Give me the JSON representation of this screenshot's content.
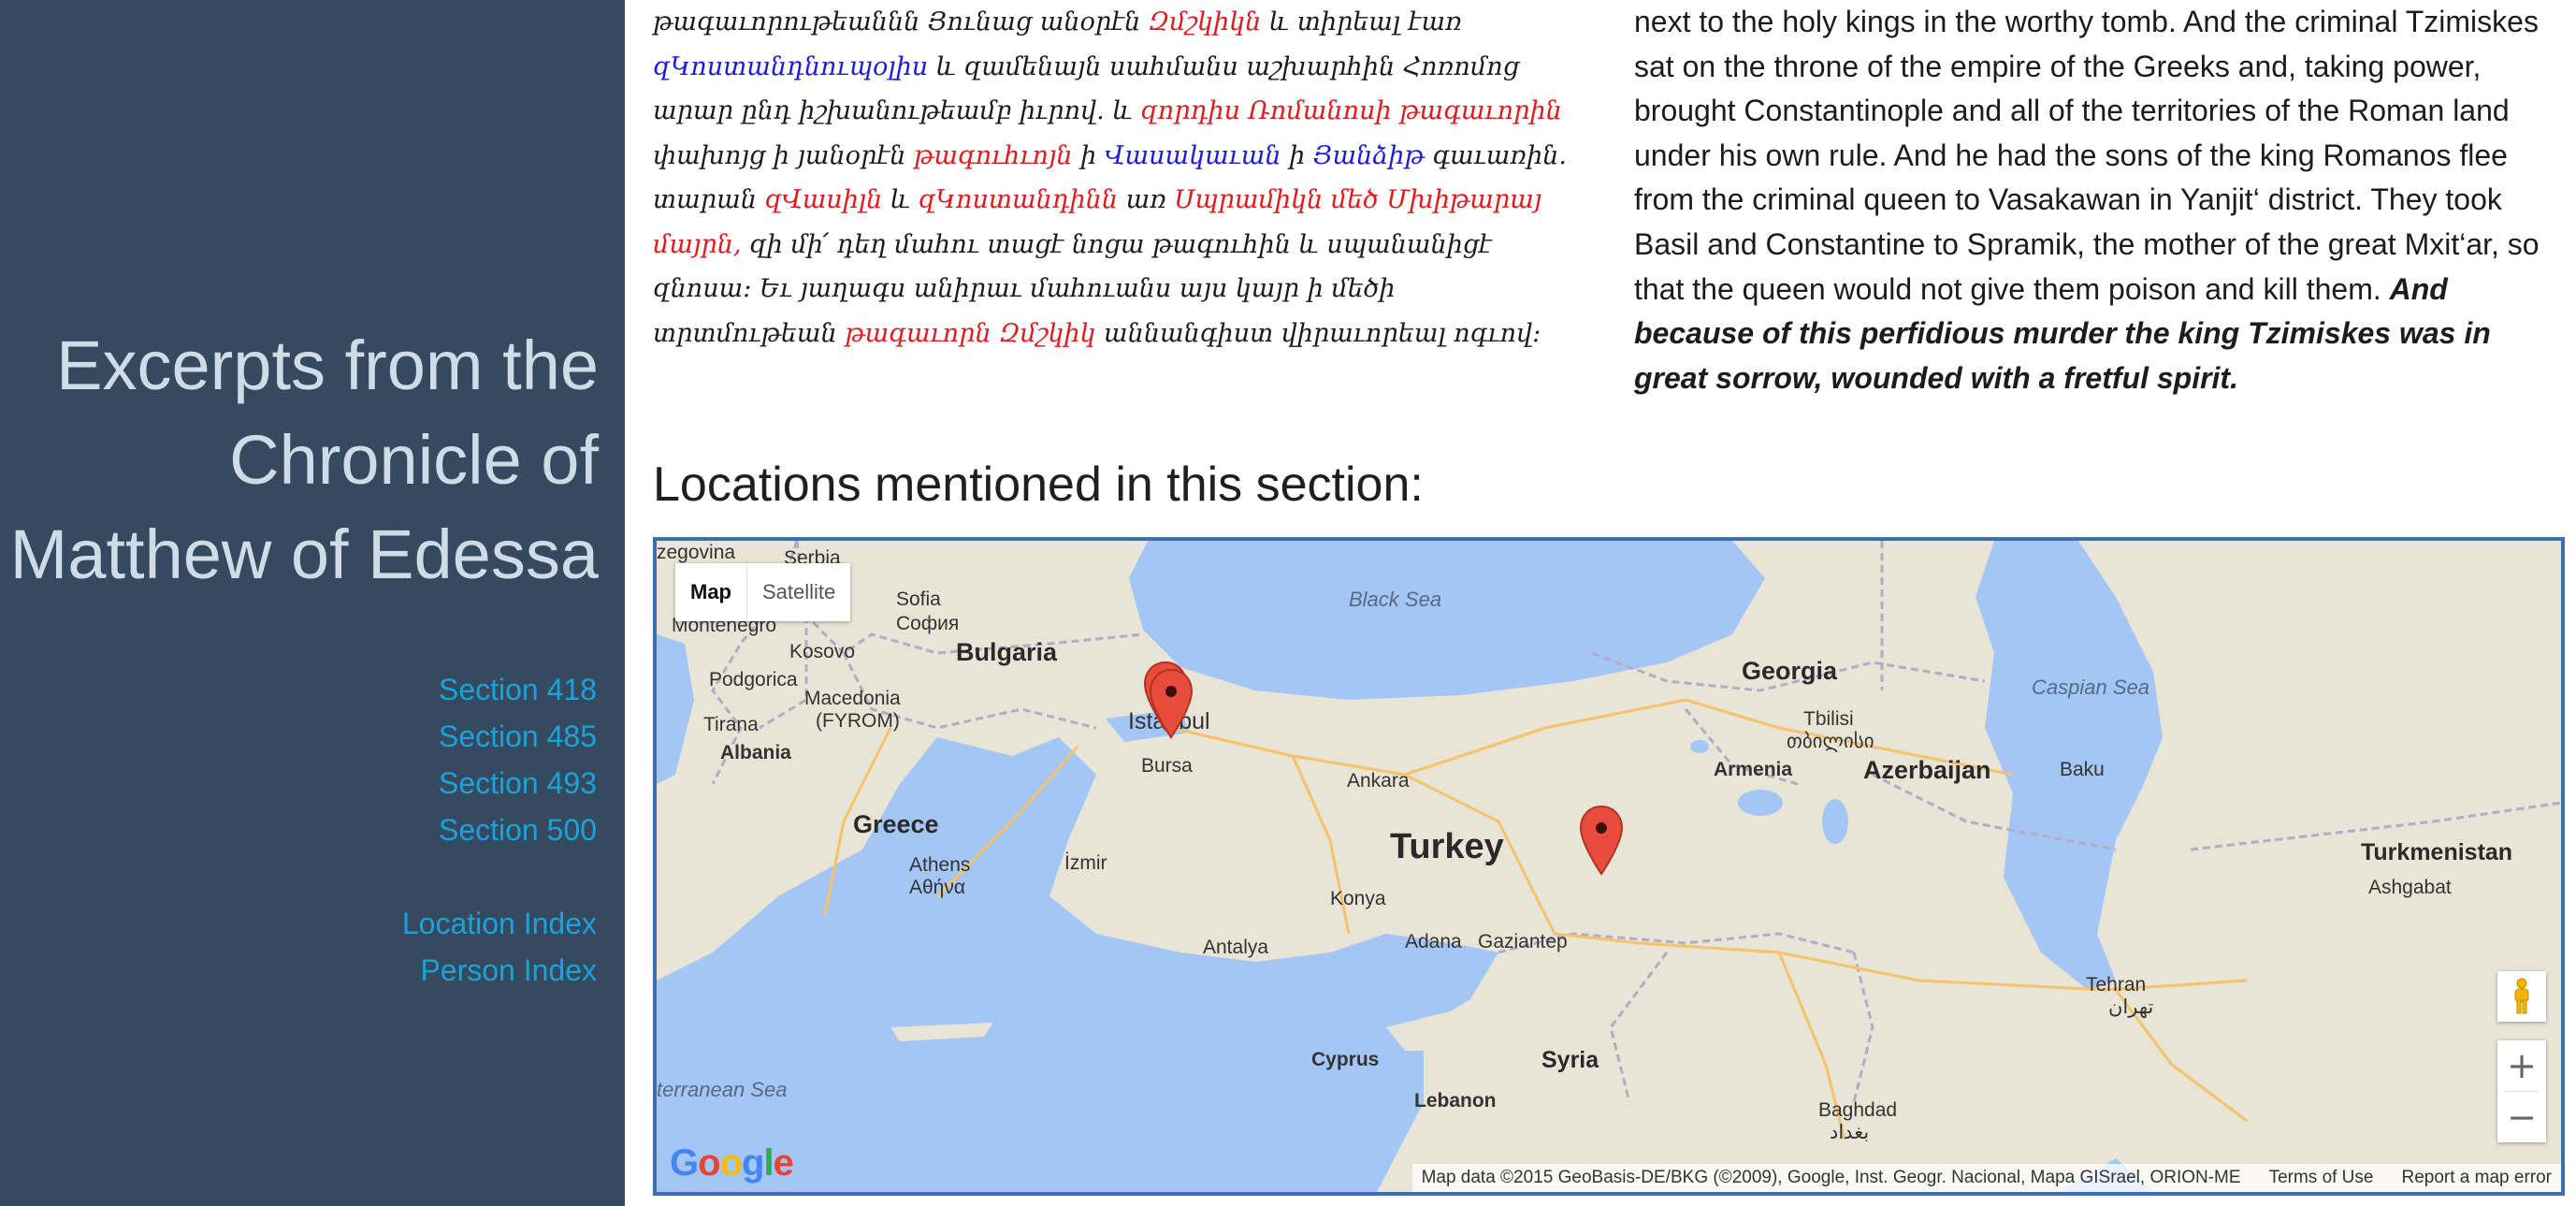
{
  "sidebar": {
    "title": "Excerpts from the Chronicle of Matthew of Edessa",
    "sections": [
      "Section 418",
      "Section 485",
      "Section 493",
      "Section 500"
    ],
    "indexes": [
      "Location Index",
      "Person Index"
    ]
  },
  "armenian": {
    "s1": "թագաւորութեաննն Յունաց անօրէն ",
    "s2": "Զմշկիկն",
    "s3": " և տիրեալ էառ ",
    "s4": "զԿոստանդնուպօլիս",
    "s5": " և զամենայն սահմանս աշխարհին Հոռոմոց արար ընդ իշխանութեամբ իւրով. և ",
    "s6": "զորդիս Ռոմանոսի թագաւորին",
    "s7": " փախոյց ի յանօրէն ",
    "s8": "թագուհւոյն",
    "s9": " ի ",
    "s10": "Վասակաւան",
    "s11": " ի ",
    "s12": "Յանձիթ",
    "s13": " գաւառին. տարան ",
    "s14": "զՎասիլն",
    "s15": " և ",
    "s16": "զԿոստանդինն",
    "s17": " առ ",
    "s18": "Սպրամիկն մեծ Մխիթարայ մայրն,",
    "s19": " զի մի՛ դեղ մահու տացէ նոցա թագուհին և սպանանիցէ զնոսա: Եւ յաղագս անիրաւ մահուանս այս կայր ի մեծի տրտմութեան ",
    "s20": "թագաւորն Զմշկիկ",
    "s21": " աննանգիստ վիրաւորեալ ոգւով:"
  },
  "english": {
    "plain": "next to the holy kings in the worthy tomb. And the criminal Tzimiskes sat on the throne of the empire of the Greeks and, taking power, brought Constantinople and all of the territories of the Roman land under his own rule. And he had the sons of the king Romanos flee from the criminal queen to Vasakawan in Yanjit‘ district. They took Basil and Constantine to Spramik, the mother of the great Mxit‘ar, so that the queen would not give them poison and kill them. ",
    "emphasis": "And because of this perfidious murder the king Tzimiskes was in great sorrow, wounded with a fretful spirit."
  },
  "locations_heading": "Locations mentioned in this section:",
  "map": {
    "type_buttons": {
      "map": "Map",
      "satellite": "Satellite"
    },
    "zoom": {
      "in": "+",
      "out": "−"
    },
    "logo": [
      "G",
      "o",
      "o",
      "g",
      "l",
      "e"
    ],
    "attribution": {
      "data": "Map data ©2015 GeoBasis-DE/BKG (©2009), Google, Inst. Geogr. Nacional, Mapa GISrael, ORION-ME",
      "terms": "Terms of Use",
      "report": "Report a map error"
    },
    "labels": {
      "zegovina": "zegovina",
      "serbia": "Serbia",
      "montenegro": "Montenegro",
      "kosovo": "Kosovo",
      "podgorica": "Podgorica",
      "sofia": "Sofia",
      "sofia_cyr": "София",
      "bulgaria": "Bulgaria",
      "black_sea": "Black Sea",
      "georgia": "Georgia",
      "caspian_sea": "Caspian Sea",
      "macedonia": "Macedonia",
      "fyrom": "(FYROM)",
      "tirana": "Tirana",
      "albania": "Albania",
      "istanbul": "Istanbul",
      "bursa": "Bursa",
      "ankara": "Ankara",
      "tbilisi": "Tbilisi",
      "tbilisi_geo": "თბილისი",
      "armenia": "Armenia",
      "azerbaijan": "Azerbaijan",
      "baku": "Baku",
      "greece": "Greece",
      "izmir": "İzmir",
      "turkey": "Turkey",
      "turkmenistan": "Turkmenistan",
      "ashgabat": "Ashgabat",
      "athens": "Athens",
      "athens_gr": "Αθήνα",
      "konya": "Konya",
      "antalya": "Antalya",
      "adana": "Adana",
      "gaziantep": "Gaziantep",
      "tehran": "Tehran",
      "tehran_fa": "تهران",
      "syria": "Syria",
      "cyprus": "Cyprus",
      "mediterranean": "terranean Sea",
      "lebanon": "Lebanon",
      "baghdad": "Baghdad",
      "baghdad_ar": "بغداد"
    },
    "colors": {
      "water": "#a3c6f5",
      "land": "#e8e4d6",
      "border": "#3d6fb0",
      "marker": "#e74c3c"
    }
  }
}
